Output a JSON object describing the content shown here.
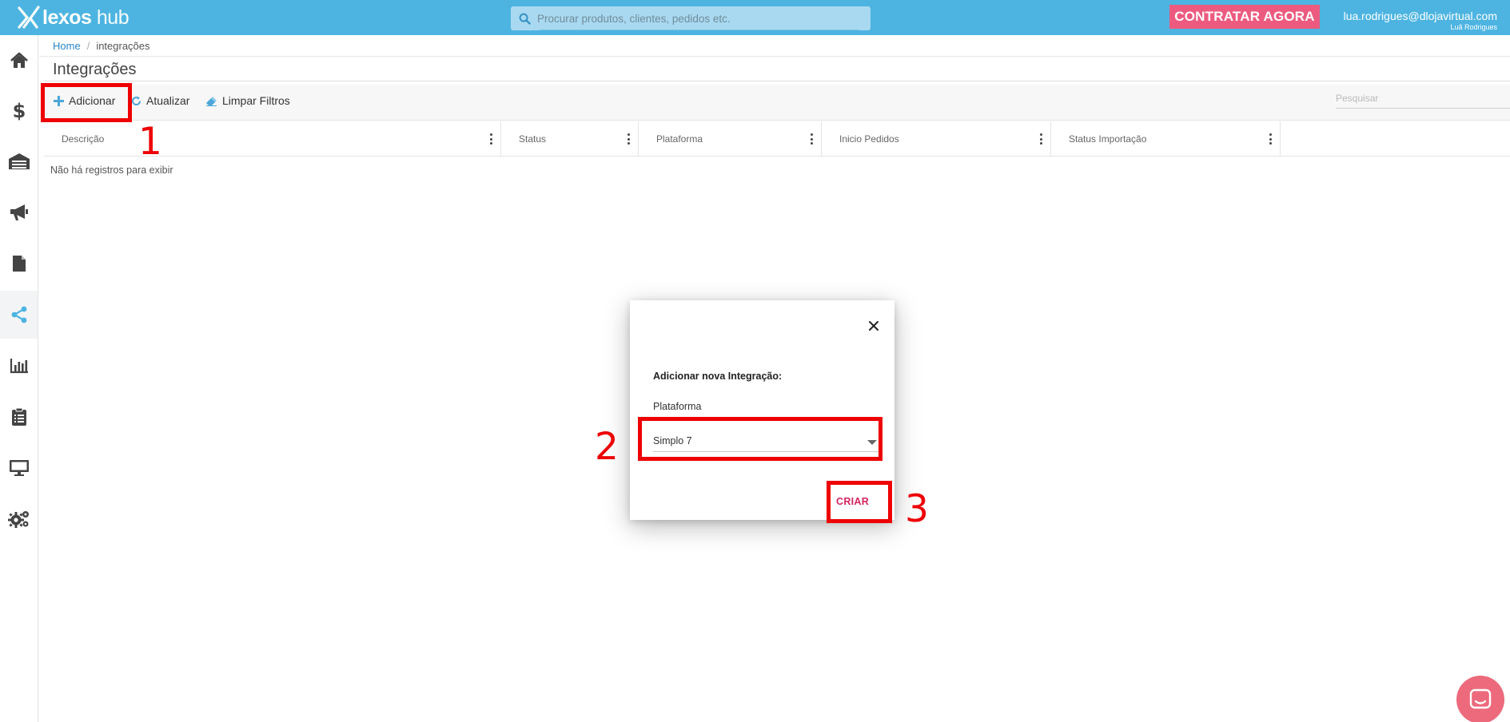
{
  "header": {
    "logo_text_bold": "lexos",
    "logo_text_light": "hub",
    "search_placeholder": "Procurar produtos, clientes, pedidos etc.",
    "cta_label": "CONTRATAR AGORA",
    "user_email": "lua.rodrigues@dlojavirtual.com",
    "user_name": "Luã Rodrigues"
  },
  "sidebar": {
    "items": [
      {
        "icon": "home-icon"
      },
      {
        "icon": "dollar-icon"
      },
      {
        "icon": "warehouse-icon"
      },
      {
        "icon": "megaphone-icon"
      },
      {
        "icon": "document-icon"
      },
      {
        "icon": "share-icon",
        "active": true
      },
      {
        "icon": "bar-chart-icon"
      },
      {
        "icon": "clipboard-icon"
      },
      {
        "icon": "monitor-icon"
      },
      {
        "icon": "gears-icon"
      }
    ],
    "accent": "#4db4e1",
    "icon_color": "#444444"
  },
  "breadcrumb": {
    "home": "Home",
    "separator": "/",
    "current": "integrações"
  },
  "page": {
    "title": "Integrações"
  },
  "toolbar": {
    "add_label": "Adicionar",
    "refresh_label": "Atualizar",
    "clear_filters_label": "Limpar Filtros",
    "search_placeholder": "Pesquisar"
  },
  "table": {
    "columns": [
      "Descrição",
      "Status",
      "Plataforma",
      "Inicio Pedidos",
      "Status Importação"
    ],
    "empty_message": "Não há registros para exibir"
  },
  "modal": {
    "title": "Adicionar nova Integração:",
    "platform_label": "Plataforma",
    "platform_value": "Simplo 7",
    "create_label": "CRIAR"
  },
  "annotations": {
    "step1": "1",
    "step2": "2",
    "step3": "3",
    "color": "#ee0000"
  },
  "colors": {
    "topbar": "#4db4e1",
    "cta": "#ec5b7f",
    "link": "#2a86c8",
    "create": "#d6245e",
    "chat": "#ec6a7c"
  }
}
